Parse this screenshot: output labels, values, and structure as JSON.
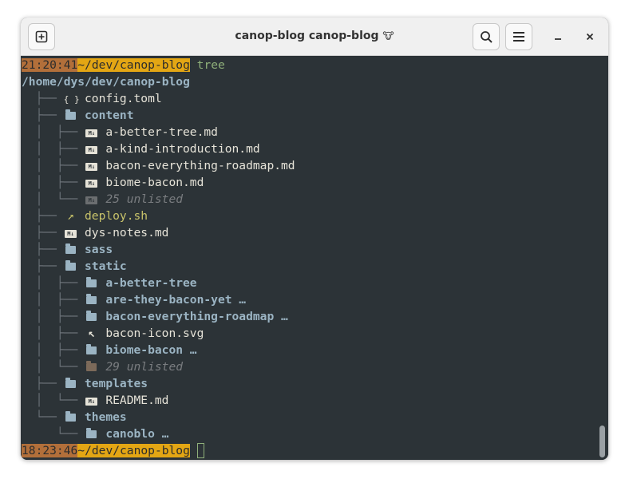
{
  "window": {
    "title": "canop-blog canop-blog",
    "title_emoji": "🐮",
    "buttons": {
      "new_tab_icon": "plus-in-square-icon",
      "search_icon": "search-icon",
      "menu_icon": "hamburger-menu-icon",
      "minimize_label": "–",
      "close_label": "×"
    }
  },
  "prompt1": {
    "time": "21:20:41",
    "path": "~/dev/canop-blog",
    "command": " tree"
  },
  "root_path": "/home/dys/dev/canop-blog",
  "tree": [
    {
      "prefix": "├──",
      "icon": "{ }",
      "name": "config.toml"
    },
    {
      "prefix": "├──",
      "icon": "folder",
      "name": "content"
    },
    {
      "prefix": "│  ├──",
      "icon": "md",
      "name": "a-better-tree.md"
    },
    {
      "prefix": "│  ├──",
      "icon": "md",
      "name": "a-kind-introduction.md"
    },
    {
      "prefix": "│  ├──",
      "icon": "md",
      "name": "bacon-everything-roadmap.md"
    },
    {
      "prefix": "│  ├──",
      "icon": "md",
      "name": "biome-bacon.md"
    },
    {
      "prefix": "│  └──",
      "icon": "md-dim",
      "name": "25 unlisted"
    },
    {
      "prefix": "├──",
      "icon": "↗",
      "name": "deploy.sh"
    },
    {
      "prefix": "├──",
      "icon": "md",
      "name": "dys-notes.md"
    },
    {
      "prefix": "├──",
      "icon": "folder",
      "name": "sass"
    },
    {
      "prefix": "├──",
      "icon": "folder",
      "name": "static"
    },
    {
      "prefix": "│  ├──",
      "icon": "folder",
      "name": "a-better-tree"
    },
    {
      "prefix": "│  ├──",
      "icon": "folder",
      "name": "are-they-bacon-yet …"
    },
    {
      "prefix": "│  ├──",
      "icon": "folder",
      "name": "bacon-everything-roadmap …"
    },
    {
      "prefix": "│  ├──",
      "icon": "↖",
      "name": "bacon-icon.svg"
    },
    {
      "prefix": "│  ├──",
      "icon": "folder",
      "name": "biome-bacon …"
    },
    {
      "prefix": "│  └──",
      "icon": "folder-dim",
      "name": "29 unlisted"
    },
    {
      "prefix": "├──",
      "icon": "folder",
      "name": "templates"
    },
    {
      "prefix": "│  └──",
      "icon": "md",
      "name": "README.md"
    },
    {
      "prefix": "└──",
      "icon": "folder",
      "name": "themes"
    },
    {
      "prefix": "   └──",
      "icon": "folder",
      "name": "canoblo …"
    }
  ],
  "prompt2": {
    "time": "18:23:46",
    "path": "~/dev/canop-blog"
  },
  "md_badge": "M↓"
}
